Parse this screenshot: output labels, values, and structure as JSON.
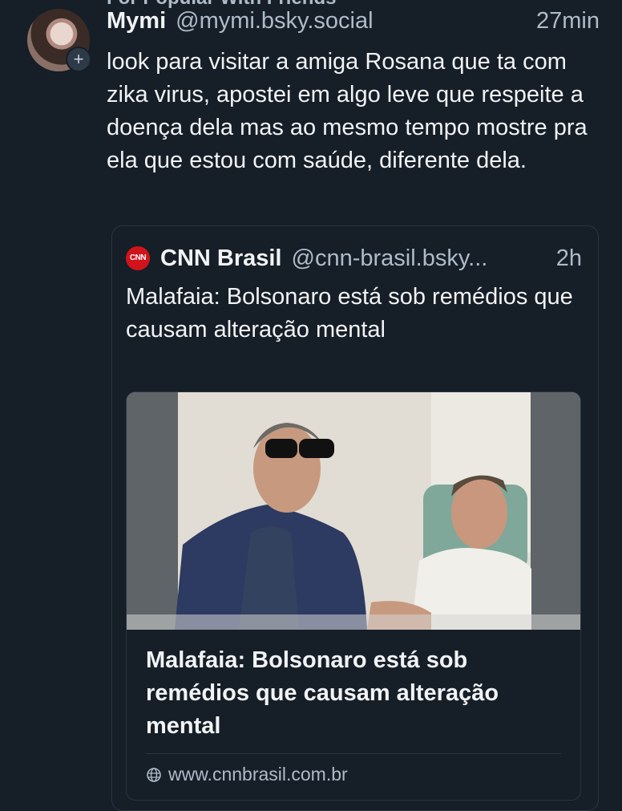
{
  "feed": {
    "label": "For Popular With Friends"
  },
  "post": {
    "author_name": "Mymi",
    "author_handle": "@mymi.bsky.social",
    "time": "27min",
    "text": "look para visitar a amiga Rosana que ta com zika virus, apostei em algo leve que respeite a doença dela mas ao mesmo tempo mostre pra ela que estou com saúde, diferente dela.",
    "follow_icon": "plus-icon"
  },
  "quote": {
    "logo_text": "CNN",
    "author_name": "CNN Brasil",
    "author_handle": "@cnn-brasil.bsky...",
    "time": "2h",
    "text": "Malafaia: Bolsonaro está sob remédios que causam alteração mental",
    "link_card": {
      "title": "Malafaia: Bolsonaro está sob remédios que causam alteração mental",
      "domain": "www.cnnbrasil.com.br",
      "domain_icon": "globe-icon"
    }
  },
  "colors": {
    "background": "#161e27",
    "text_primary": "#f1f3f5",
    "text_secondary": "#aebbc9",
    "border": "#2b3644",
    "cnn_red": "#d1141b"
  }
}
